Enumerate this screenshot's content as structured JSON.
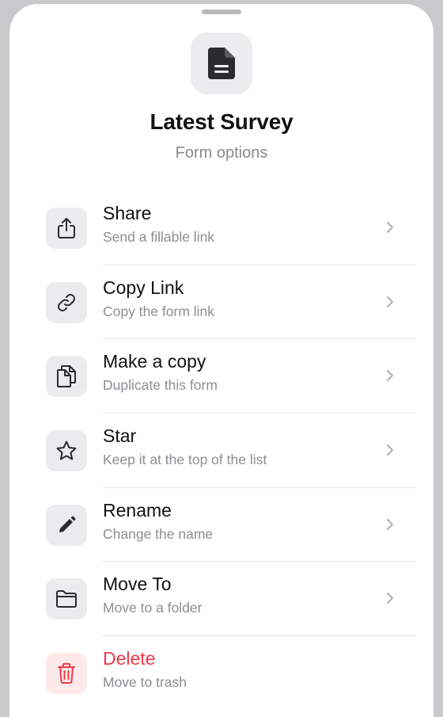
{
  "header": {
    "title": "Latest Survey",
    "subtitle": "Form options",
    "icon": "document-icon"
  },
  "menu": {
    "items": [
      {
        "label": "Share",
        "description": "Send a fillable link",
        "icon": "share-icon"
      },
      {
        "label": "Copy Link",
        "description": "Copy the form link",
        "icon": "link-icon"
      },
      {
        "label": "Make a copy",
        "description": "Duplicate this form",
        "icon": "duplicate-icon"
      },
      {
        "label": "Star",
        "description": "Keep it at the top of the list",
        "icon": "star-icon"
      },
      {
        "label": "Rename",
        "description": "Change the name",
        "icon": "pencil-icon"
      },
      {
        "label": "Move To",
        "description": "Move to a folder",
        "icon": "folder-icon"
      },
      {
        "label": "Delete",
        "description": "Move to trash",
        "icon": "trash-icon"
      }
    ]
  },
  "colors": {
    "danger": "#f2384a",
    "tile": "#ececee",
    "danger_tile": "#fde8ea"
  }
}
